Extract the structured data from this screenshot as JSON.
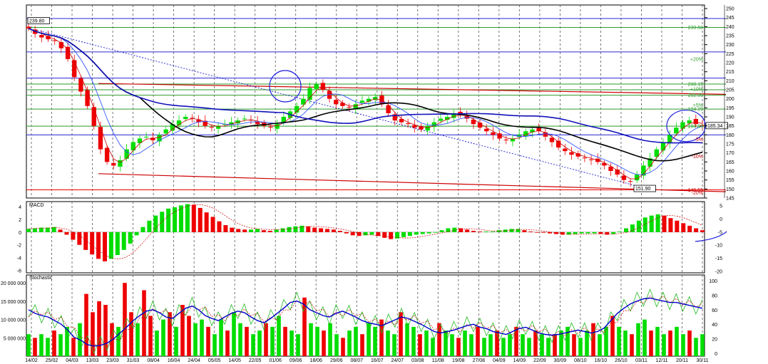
{
  "colors": {
    "up": "#00dd00",
    "down": "#ee0000",
    "blue": "#0000cc",
    "black": "#000000",
    "darkred": "#cc0000",
    "grid": "#555555",
    "hline_green": "#2e9b2e",
    "hline_blue": "#2a2ad0",
    "annot": "#2222dd"
  },
  "chart_data": [
    {
      "type": "candlestick",
      "name_hint": "price",
      "y_ticks": [
        145,
        150,
        155,
        160,
        165,
        170,
        175,
        180,
        185,
        190,
        195,
        200,
        205,
        210,
        215,
        220,
        225,
        230,
        235,
        240,
        245,
        250
      ],
      "ylim": [
        145,
        252
      ],
      "x_labels": [
        "14/02",
        "25/02",
        "04/03",
        "13/03",
        "23/03",
        "31/03",
        "08/04",
        "16/04",
        "24/04",
        "05/05",
        "14/05",
        "22/05",
        "01/06",
        "09/06",
        "18/06",
        "29/06",
        "08/07",
        "16/07",
        "24/07",
        "03/08",
        "11/08",
        "19/08",
        "27/08",
        "04/09",
        "14/09",
        "22/09",
        "30/09",
        "08/10",
        "16/10",
        "26/10",
        "03/11",
        "12/11",
        "20/11",
        "30/11"
      ],
      "labels": {
        "start_price": "239.80",
        "low_price": "151.90",
        "current_price": "185.34",
        "level_1": "239.58",
        "level_2": "208.15",
        "level_3": "202.00",
        "level_4": "194.29",
        "level_5": "184.84",
        "level_6": "149.55",
        "pct_20": "+20%",
        "pct_10": "+10%",
        "pct_5": "+5%",
        "pct_m5": "-5%",
        "pct_m10": "-10%",
        "pct_m20": "-20%"
      },
      "horizontal_levels": [
        {
          "value": 244.5,
          "color": "blue"
        },
        {
          "value": 239.58,
          "color": "green"
        },
        {
          "value": 226,
          "color": "blue"
        },
        {
          "value": 211.5,
          "color": "blue"
        },
        {
          "value": 208.15,
          "color": "green"
        },
        {
          "value": 205,
          "color": "green"
        },
        {
          "value": 202.0,
          "color": "green"
        },
        {
          "value": 194.29,
          "color": "green"
        },
        {
          "value": 184.84,
          "color": "green"
        },
        {
          "value": 180,
          "color": "blue"
        },
        {
          "value": 149.55,
          "color": "red"
        }
      ],
      "closes": [
        239,
        236,
        234,
        233,
        232,
        228,
        222,
        212,
        204,
        196,
        185,
        172,
        165,
        163,
        166,
        172,
        176,
        178,
        179,
        177,
        180,
        183,
        186,
        188,
        190,
        189,
        187,
        185,
        184,
        185,
        186,
        187,
        188,
        189,
        188,
        186,
        185,
        184,
        186,
        190,
        193,
        196,
        200,
        206,
        208,
        205,
        200,
        197,
        196,
        195,
        197,
        199,
        200,
        201,
        197,
        192,
        188,
        187,
        186,
        184,
        183,
        185,
        187,
        189,
        190,
        192,
        191,
        189,
        186,
        184,
        182,
        180,
        178,
        177,
        178,
        180,
        182,
        183,
        182,
        179,
        176,
        173,
        171,
        169,
        168,
        167,
        166,
        165,
        163,
        160,
        158,
        155,
        154,
        158,
        163,
        167,
        172,
        176,
        180,
        184,
        187,
        188,
        186,
        185
      ]
    },
    {
      "type": "bar",
      "name": "MACD",
      "y_ticks": [
        4,
        2,
        0,
        -2,
        -4,
        -6
      ],
      "right_ticks": [
        5,
        0,
        -5,
        -10,
        -15,
        -20
      ],
      "histogram": [
        0.5,
        0.6,
        0.7,
        0.7,
        0.8,
        0.4,
        -0.4,
        -1.2,
        -2.0,
        -2.8,
        -3.5,
        -4.2,
        -4.6,
        -4.2,
        -3.6,
        -2.8,
        -1.8,
        -0.5,
        0.8,
        1.8,
        2.6,
        3.2,
        3.7,
        3.9,
        4.2,
        4.4,
        4.3,
        3.8,
        3.1,
        2.4,
        1.7,
        1.1,
        0.7,
        0.5,
        0.4,
        0.4,
        0.5,
        0.3,
        0.2,
        0.4,
        0.6,
        0.8,
        0.9,
        1.0,
        0.9,
        0.7,
        0.6,
        0.5,
        0.4,
        0.2,
        -0.2,
        -0.5,
        -0.6,
        -0.5,
        -0.4,
        -0.6,
        -0.9,
        -1.1,
        -1.0,
        -0.8,
        -0.6,
        -0.4,
        -0.3,
        -0.2,
        0.0,
        0.3,
        0.6,
        0.7,
        0.6,
        0.4,
        0.2,
        0.1,
        0.1,
        0.1,
        0.3,
        0.4,
        0.5,
        0.5,
        0.3,
        0.1,
        0.0,
        -0.1,
        -0.2,
        -0.3,
        -0.4,
        -0.4,
        -0.3,
        -0.2,
        -0.2,
        -0.2,
        -0.3,
        -0.4,
        -0.3,
        0.1,
        0.6,
        1.2,
        1.8,
        2.3,
        2.6,
        2.8,
        2.6,
        2.2,
        1.8,
        1.4,
        1.0,
        0.6,
        0.3
      ]
    },
    {
      "type": "line",
      "name": "Stochastic",
      "y_ticks": [
        "20 000 000",
        "15 000 000",
        "10 000 000",
        "5 000 000"
      ],
      "right_ticks": [
        100,
        80,
        60,
        40,
        20,
        0
      ],
      "volume_millions": [
        6,
        5,
        6,
        5,
        7,
        6,
        8,
        5,
        9,
        17,
        12,
        15,
        14,
        9,
        8,
        20,
        12,
        9,
        18,
        11,
        7,
        10,
        12,
        8,
        14,
        11,
        9,
        10,
        8,
        6,
        10,
        7,
        12,
        9,
        8,
        6,
        7,
        9,
        8,
        11,
        8,
        7,
        6,
        16,
        9,
        8,
        7,
        9,
        6,
        5,
        7,
        8,
        6,
        9,
        8,
        10,
        7,
        6,
        12,
        9,
        8,
        6,
        7,
        5,
        9,
        7,
        6,
        5,
        7,
        6,
        8,
        5,
        6,
        7,
        5,
        6,
        8,
        6,
        5,
        7,
        6,
        5,
        6,
        7,
        8,
        6,
        5,
        7,
        9,
        6,
        8,
        11,
        8,
        7,
        6,
        9,
        10,
        7,
        8,
        6,
        7,
        8,
        6,
        7,
        5,
        6
      ],
      "k": [
        60,
        55,
        52,
        50,
        45,
        40,
        32,
        22,
        18,
        12,
        10,
        11,
        14,
        20,
        28,
        36,
        45,
        52,
        58,
        60,
        56,
        50,
        48,
        55,
        62,
        65,
        60,
        52,
        48,
        45,
        50,
        55,
        58,
        56,
        50,
        45,
        42,
        48,
        55,
        62,
        70,
        72,
        68,
        60,
        56,
        52,
        50,
        55,
        58,
        54,
        50,
        45,
        42,
        40,
        38,
        42,
        46,
        50,
        48,
        44,
        40,
        35,
        30,
        28,
        30,
        32,
        35,
        38,
        40,
        36,
        34,
        30,
        28,
        26,
        30,
        34,
        36,
        32,
        28,
        26,
        25,
        26,
        28,
        30,
        32,
        30,
        28,
        30,
        35,
        45,
        55,
        62,
        68,
        72,
        75,
        76,
        74,
        72,
        70,
        70,
        68,
        66,
        64,
        62
      ]
    }
  ]
}
